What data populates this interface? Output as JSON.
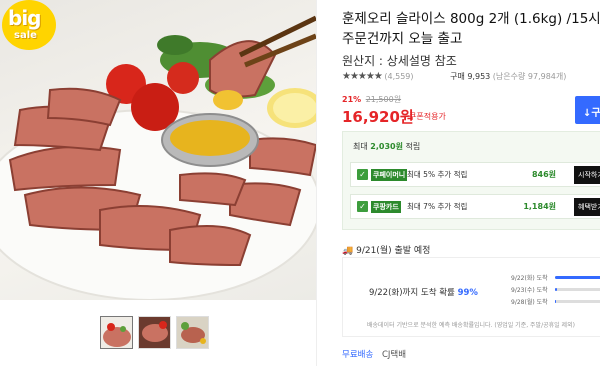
{
  "product": {
    "title": "훈제오리 슬라이스 800g 2개 (1.6kg) /15시 주문건까지 오늘 출고",
    "origin": "원산지 : 상세설명 참조",
    "badge": {
      "line1": "big",
      "line2": "sale"
    }
  },
  "rating": {
    "stars": "★★★★★",
    "count": "(4,559)",
    "buy_count": "구매 9,953",
    "stock": "(남은수량 97,984개)"
  },
  "price": {
    "discount_pct": "21%",
    "original": "21,500원",
    "final": "16,920원",
    "coupon_label": "쿠폰적용가",
    "cart_button": "구"
  },
  "cashback": {
    "header_prefix": "최대",
    "header_amount": "2,030원",
    "header_suffix": "적립",
    "items": [
      {
        "brand": "쿠페이머니",
        "desc": "최대 5% 추가 적립",
        "amount": "846원",
        "action": "시작하기",
        "brand_color": "#2c8a2c"
      },
      {
        "brand": "쿠팡카드",
        "desc": "최대 7% 추가 적립",
        "amount": "1,184원",
        "action": "혜택받기",
        "brand_color": "#2c8a2c"
      }
    ]
  },
  "shipping": {
    "title": "9/21(월) 출발 예정",
    "forecast_text": "9/22(화)까지 도착 확률",
    "forecast_pct": "99%",
    "bars": [
      {
        "label": "9/22(화) 도착",
        "level": 0.95
      },
      {
        "label": "9/23(수) 도착",
        "level": 0.03
      },
      {
        "label": "9/28(월) 도착",
        "level": 0.02
      }
    ],
    "note": "배송데이터 기반으로 분석한 예측 배송확률입니다. (영업일 기준, 주말/공휴일 제외)",
    "free_label": "무료배송",
    "carrier": "CJ택배"
  },
  "thumbnails": [
    "thumbnail-1",
    "thumbnail-2",
    "thumbnail-3"
  ],
  "colors": {
    "accent_red": "#e52528",
    "accent_blue": "#346aff",
    "green": "#2c8a2c",
    "badge_yellow": "#ffd400"
  }
}
